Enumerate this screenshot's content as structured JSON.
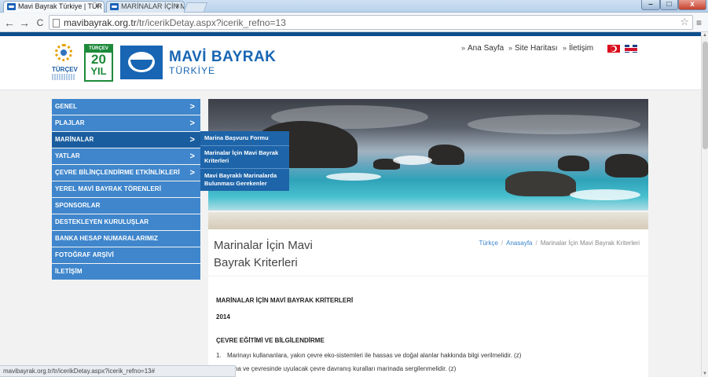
{
  "browser": {
    "tabs": [
      {
        "title": "Mavi Bayrak Türkiye | TÜR",
        "active": true
      },
      {
        "title": "MARİNALAR İÇİN MAVİ B",
        "active": false
      }
    ],
    "tab_close_glyph": "×",
    "url_host": "mavibayrak.org.tr",
    "url_path": "/tr/icerikDetay.aspx?icerik_refno=13",
    "nav_back": "←",
    "nav_forward": "→",
    "nav_reload": "C",
    "bookmark_glyph": "☆",
    "menu_glyph": "≡",
    "window_controls": {
      "minimize": "–",
      "maximize": "□",
      "close": "x"
    },
    "status_url": "mavibayrak.org.tr/tr/icerikDetay.aspx?icerik_refno=13#"
  },
  "header": {
    "turcev_label": "TÜRÇEV",
    "logo20": {
      "top": "TÜRÇEV",
      "number": "20",
      "word": "YIL"
    },
    "brand_title": "MAVİ BAYRAK",
    "brand_subtitle": "TÜRKİYE",
    "topnav": [
      {
        "label": "Ana Sayfa"
      },
      {
        "label": "Site Haritası"
      },
      {
        "label": "İletişim"
      }
    ],
    "topnav_chevron": "»"
  },
  "sidebar": {
    "arrow": ">",
    "items": [
      {
        "label": "GENEL",
        "has_arrow": true
      },
      {
        "label": "PLAJLAR",
        "has_arrow": true
      },
      {
        "label": "MARİNALAR",
        "has_arrow": true,
        "active": true
      },
      {
        "label": "YATLAR",
        "has_arrow": true
      },
      {
        "label": "ÇEVRE BİLİNÇLENDİRME ETKİNLİKLERİ",
        "has_arrow": true
      },
      {
        "label": "YEREL MAVİ BAYRAK TÖRENLERİ",
        "has_arrow": false
      },
      {
        "label": "SPONSORLAR",
        "has_arrow": false
      },
      {
        "label": "DESTEKLEYEN KURULUŞLAR",
        "has_arrow": false
      },
      {
        "label": "BANKA HESAP NUMARALARIMIZ",
        "has_arrow": false
      },
      {
        "label": "FOTOĞRAF ARŞİVİ",
        "has_arrow": false
      },
      {
        "label": "İLETİŞİM",
        "has_arrow": false
      }
    ]
  },
  "submenu": {
    "items": [
      {
        "label": "Marina Başvuru Formu"
      },
      {
        "label": "Marinalar İçin Mavi Bayrak Kriterleri"
      },
      {
        "label": "Mavi Bayraklı Marinalarda Bulunması Gerekenler"
      }
    ]
  },
  "page": {
    "title": "Marinalar İçin Mavi Bayrak Kriterleri",
    "breadcrumb": [
      {
        "label": "Türkçe",
        "link": true
      },
      {
        "label": "Anasayfa",
        "link": true
      },
      {
        "label": "Marinalar İçin Mavi Bayrak Kriterleri",
        "link": false
      }
    ],
    "breadcrumb_sep": "/"
  },
  "content": {
    "heading": "MARİNALAR İÇİN MAVİ BAYRAK KRİTERLERİ",
    "year": "2014",
    "section": "ÇEVRE EĞİTİMİ VE BİLGİLENDİRME",
    "items": [
      {
        "num": "1.",
        "text": "Marinayı kullananlara, yakın çevre eko-sistemleri ile hassas ve doğal alanlar hakkında bilgi verilmelidir. (z)"
      },
      {
        "num": "",
        "text": "arina ve çevresinde uyulacak çevre davranış kuralları marinada sergilenmelidir. (z)"
      }
    ]
  },
  "colors": {
    "brand_blue": "#1765b3",
    "menu_blue": "#3f86cc",
    "menu_active": "#1a5d9e",
    "link_blue": "#3a84c9"
  }
}
